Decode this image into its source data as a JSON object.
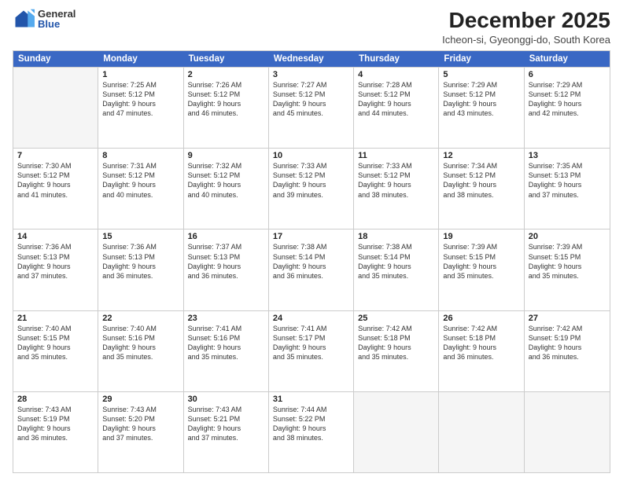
{
  "logo": {
    "general": "General",
    "blue": "Blue"
  },
  "title": "December 2025",
  "subtitle": "Icheon-si, Gyeonggi-do, South Korea",
  "header_days": [
    "Sunday",
    "Monday",
    "Tuesday",
    "Wednesday",
    "Thursday",
    "Friday",
    "Saturday"
  ],
  "weeks": [
    [
      {
        "day": "",
        "info": "",
        "empty": true
      },
      {
        "day": "1",
        "info": "Sunrise: 7:25 AM\nSunset: 5:12 PM\nDaylight: 9 hours\nand 47 minutes."
      },
      {
        "day": "2",
        "info": "Sunrise: 7:26 AM\nSunset: 5:12 PM\nDaylight: 9 hours\nand 46 minutes."
      },
      {
        "day": "3",
        "info": "Sunrise: 7:27 AM\nSunset: 5:12 PM\nDaylight: 9 hours\nand 45 minutes."
      },
      {
        "day": "4",
        "info": "Sunrise: 7:28 AM\nSunset: 5:12 PM\nDaylight: 9 hours\nand 44 minutes."
      },
      {
        "day": "5",
        "info": "Sunrise: 7:29 AM\nSunset: 5:12 PM\nDaylight: 9 hours\nand 43 minutes."
      },
      {
        "day": "6",
        "info": "Sunrise: 7:29 AM\nSunset: 5:12 PM\nDaylight: 9 hours\nand 42 minutes."
      }
    ],
    [
      {
        "day": "7",
        "info": "Sunrise: 7:30 AM\nSunset: 5:12 PM\nDaylight: 9 hours\nand 41 minutes."
      },
      {
        "day": "8",
        "info": "Sunrise: 7:31 AM\nSunset: 5:12 PM\nDaylight: 9 hours\nand 40 minutes."
      },
      {
        "day": "9",
        "info": "Sunrise: 7:32 AM\nSunset: 5:12 PM\nDaylight: 9 hours\nand 40 minutes."
      },
      {
        "day": "10",
        "info": "Sunrise: 7:33 AM\nSunset: 5:12 PM\nDaylight: 9 hours\nand 39 minutes."
      },
      {
        "day": "11",
        "info": "Sunrise: 7:33 AM\nSunset: 5:12 PM\nDaylight: 9 hours\nand 38 minutes."
      },
      {
        "day": "12",
        "info": "Sunrise: 7:34 AM\nSunset: 5:12 PM\nDaylight: 9 hours\nand 38 minutes."
      },
      {
        "day": "13",
        "info": "Sunrise: 7:35 AM\nSunset: 5:13 PM\nDaylight: 9 hours\nand 37 minutes."
      }
    ],
    [
      {
        "day": "14",
        "info": "Sunrise: 7:36 AM\nSunset: 5:13 PM\nDaylight: 9 hours\nand 37 minutes."
      },
      {
        "day": "15",
        "info": "Sunrise: 7:36 AM\nSunset: 5:13 PM\nDaylight: 9 hours\nand 36 minutes."
      },
      {
        "day": "16",
        "info": "Sunrise: 7:37 AM\nSunset: 5:13 PM\nDaylight: 9 hours\nand 36 minutes."
      },
      {
        "day": "17",
        "info": "Sunrise: 7:38 AM\nSunset: 5:14 PM\nDaylight: 9 hours\nand 36 minutes."
      },
      {
        "day": "18",
        "info": "Sunrise: 7:38 AM\nSunset: 5:14 PM\nDaylight: 9 hours\nand 35 minutes."
      },
      {
        "day": "19",
        "info": "Sunrise: 7:39 AM\nSunset: 5:15 PM\nDaylight: 9 hours\nand 35 minutes."
      },
      {
        "day": "20",
        "info": "Sunrise: 7:39 AM\nSunset: 5:15 PM\nDaylight: 9 hours\nand 35 minutes."
      }
    ],
    [
      {
        "day": "21",
        "info": "Sunrise: 7:40 AM\nSunset: 5:15 PM\nDaylight: 9 hours\nand 35 minutes."
      },
      {
        "day": "22",
        "info": "Sunrise: 7:40 AM\nSunset: 5:16 PM\nDaylight: 9 hours\nand 35 minutes."
      },
      {
        "day": "23",
        "info": "Sunrise: 7:41 AM\nSunset: 5:16 PM\nDaylight: 9 hours\nand 35 minutes."
      },
      {
        "day": "24",
        "info": "Sunrise: 7:41 AM\nSunset: 5:17 PM\nDaylight: 9 hours\nand 35 minutes."
      },
      {
        "day": "25",
        "info": "Sunrise: 7:42 AM\nSunset: 5:18 PM\nDaylight: 9 hours\nand 35 minutes."
      },
      {
        "day": "26",
        "info": "Sunrise: 7:42 AM\nSunset: 5:18 PM\nDaylight: 9 hours\nand 36 minutes."
      },
      {
        "day": "27",
        "info": "Sunrise: 7:42 AM\nSunset: 5:19 PM\nDaylight: 9 hours\nand 36 minutes."
      }
    ],
    [
      {
        "day": "28",
        "info": "Sunrise: 7:43 AM\nSunset: 5:19 PM\nDaylight: 9 hours\nand 36 minutes."
      },
      {
        "day": "29",
        "info": "Sunrise: 7:43 AM\nSunset: 5:20 PM\nDaylight: 9 hours\nand 37 minutes."
      },
      {
        "day": "30",
        "info": "Sunrise: 7:43 AM\nSunset: 5:21 PM\nDaylight: 9 hours\nand 37 minutes."
      },
      {
        "day": "31",
        "info": "Sunrise: 7:44 AM\nSunset: 5:22 PM\nDaylight: 9 hours\nand 38 minutes."
      },
      {
        "day": "",
        "info": "",
        "empty": true
      },
      {
        "day": "",
        "info": "",
        "empty": true
      },
      {
        "day": "",
        "info": "",
        "empty": true
      }
    ]
  ]
}
